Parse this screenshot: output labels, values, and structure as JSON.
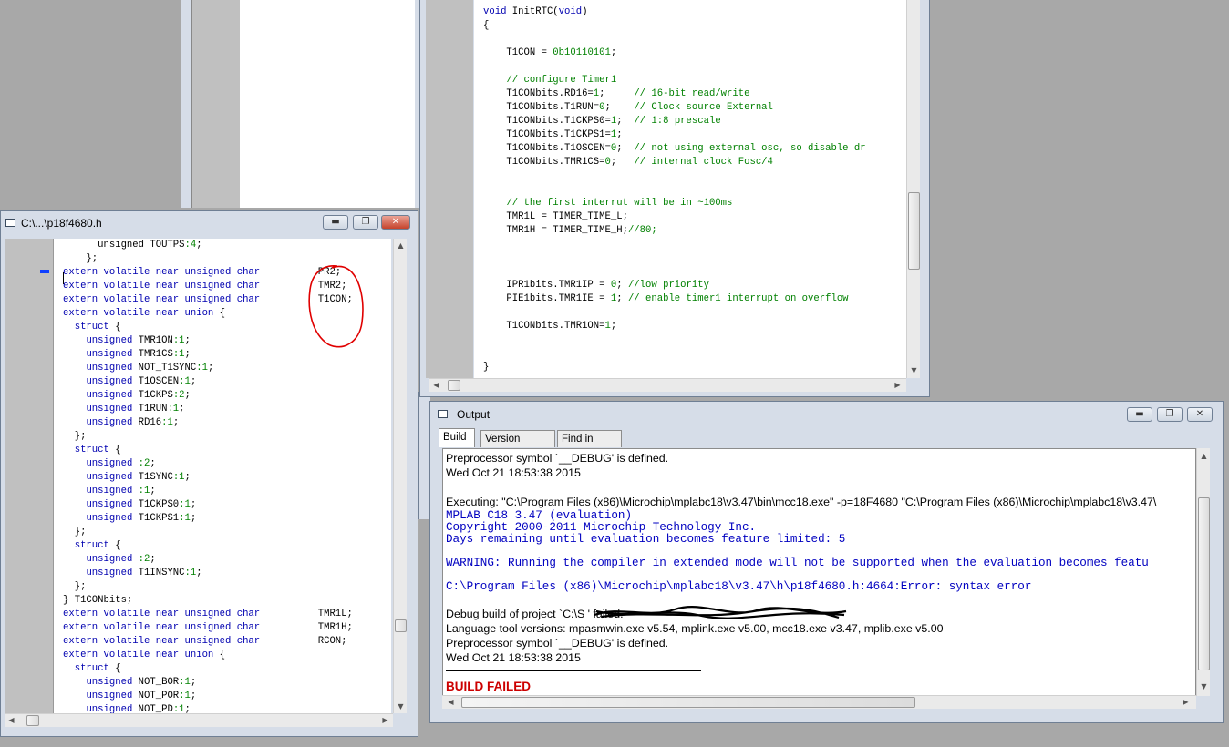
{
  "header_window": {
    "title": "C:\\...\\p18f4680.h",
    "lines": [
      [
        [
          "pl",
          "      unsigned "
        ],
        [
          "pl",
          "TOUTPS"
        ],
        [
          "nm",
          ":4"
        ],
        [
          "pl",
          ";"
        ]
      ],
      [
        [
          "pl",
          "    };"
        ]
      ],
      [
        [
          "kw",
          "extern volatile near unsigned char"
        ],
        [
          "pl",
          "          PR2;"
        ]
      ],
      [
        [
          "kw",
          "extern volatile near unsigned char"
        ],
        [
          "pl",
          "          TMR2;"
        ]
      ],
      [
        [
          "kw",
          "extern volatile near unsigned char"
        ],
        [
          "pl",
          "          T1CON;"
        ]
      ],
      [
        [
          "kw",
          "extern volatile near union"
        ],
        [
          "pl",
          " {"
        ]
      ],
      [
        [
          "pl",
          "  "
        ],
        [
          "kw",
          "struct"
        ],
        [
          "pl",
          " {"
        ]
      ],
      [
        [
          "pl",
          "    "
        ],
        [
          "kw",
          "unsigned"
        ],
        [
          "pl",
          " TMR1ON"
        ],
        [
          "nm",
          ":1"
        ],
        [
          "pl",
          ";"
        ]
      ],
      [
        [
          "pl",
          "    "
        ],
        [
          "kw",
          "unsigned"
        ],
        [
          "pl",
          " TMR1CS"
        ],
        [
          "nm",
          ":1"
        ],
        [
          "pl",
          ";"
        ]
      ],
      [
        [
          "pl",
          "    "
        ],
        [
          "kw",
          "unsigned"
        ],
        [
          "pl",
          " NOT_T1SYNC"
        ],
        [
          "nm",
          ":1"
        ],
        [
          "pl",
          ";"
        ]
      ],
      [
        [
          "pl",
          "    "
        ],
        [
          "kw",
          "unsigned"
        ],
        [
          "pl",
          " T1OSCEN"
        ],
        [
          "nm",
          ":1"
        ],
        [
          "pl",
          ";"
        ]
      ],
      [
        [
          "pl",
          "    "
        ],
        [
          "kw",
          "unsigned"
        ],
        [
          "pl",
          " T1CKPS"
        ],
        [
          "nm",
          ":2"
        ],
        [
          "pl",
          ";"
        ]
      ],
      [
        [
          "pl",
          "    "
        ],
        [
          "kw",
          "unsigned"
        ],
        [
          "pl",
          " T1RUN"
        ],
        [
          "nm",
          ":1"
        ],
        [
          "pl",
          ";"
        ]
      ],
      [
        [
          "pl",
          "    "
        ],
        [
          "kw",
          "unsigned"
        ],
        [
          "pl",
          " RD16"
        ],
        [
          "nm",
          ":1"
        ],
        [
          "pl",
          ";"
        ]
      ],
      [
        [
          "pl",
          "  };"
        ]
      ],
      [
        [
          "pl",
          "  "
        ],
        [
          "kw",
          "struct"
        ],
        [
          "pl",
          " {"
        ]
      ],
      [
        [
          "pl",
          "    "
        ],
        [
          "kw",
          "unsigned"
        ],
        [
          "pl",
          " "
        ],
        [
          "nm",
          ":2"
        ],
        [
          "pl",
          ";"
        ]
      ],
      [
        [
          "pl",
          "    "
        ],
        [
          "kw",
          "unsigned"
        ],
        [
          "pl",
          " T1SYNC"
        ],
        [
          "nm",
          ":1"
        ],
        [
          "pl",
          ";"
        ]
      ],
      [
        [
          "pl",
          "    "
        ],
        [
          "kw",
          "unsigned"
        ],
        [
          "pl",
          " "
        ],
        [
          "nm",
          ":1"
        ],
        [
          "pl",
          ";"
        ]
      ],
      [
        [
          "pl",
          "    "
        ],
        [
          "kw",
          "unsigned"
        ],
        [
          "pl",
          " T1CKPS0"
        ],
        [
          "nm",
          ":1"
        ],
        [
          "pl",
          ";"
        ]
      ],
      [
        [
          "pl",
          "    "
        ],
        [
          "kw",
          "unsigned"
        ],
        [
          "pl",
          " T1CKPS1"
        ],
        [
          "nm",
          ":1"
        ],
        [
          "pl",
          ";"
        ]
      ],
      [
        [
          "pl",
          "  };"
        ]
      ],
      [
        [
          "pl",
          "  "
        ],
        [
          "kw",
          "struct"
        ],
        [
          "pl",
          " {"
        ]
      ],
      [
        [
          "pl",
          "    "
        ],
        [
          "kw",
          "unsigned"
        ],
        [
          "pl",
          " "
        ],
        [
          "nm",
          ":2"
        ],
        [
          "pl",
          ";"
        ]
      ],
      [
        [
          "pl",
          "    "
        ],
        [
          "kw",
          "unsigned"
        ],
        [
          "pl",
          " T1INSYNC"
        ],
        [
          "nm",
          ":1"
        ],
        [
          "pl",
          ";"
        ]
      ],
      [
        [
          "pl",
          "  };"
        ]
      ],
      [
        [
          "pl",
          "} T1CONbits;"
        ]
      ],
      [
        [
          "kw",
          "extern volatile near unsigned char"
        ],
        [
          "pl",
          "          TMR1L;"
        ]
      ],
      [
        [
          "kw",
          "extern volatile near unsigned char"
        ],
        [
          "pl",
          "          TMR1H;"
        ]
      ],
      [
        [
          "kw",
          "extern volatile near unsigned char"
        ],
        [
          "pl",
          "          RCON;"
        ]
      ],
      [
        [
          "kw",
          "extern volatile near union"
        ],
        [
          "pl",
          " {"
        ]
      ],
      [
        [
          "pl",
          "  "
        ],
        [
          "kw",
          "struct"
        ],
        [
          "pl",
          " {"
        ]
      ],
      [
        [
          "pl",
          "    "
        ],
        [
          "kw",
          "unsigned"
        ],
        [
          "pl",
          " NOT_BOR"
        ],
        [
          "nm",
          ":1"
        ],
        [
          "pl",
          ";"
        ]
      ],
      [
        [
          "pl",
          "    "
        ],
        [
          "kw",
          "unsigned"
        ],
        [
          "pl",
          " NOT_POR"
        ],
        [
          "nm",
          ":1"
        ],
        [
          "pl",
          ";"
        ]
      ],
      [
        [
          "pl",
          "    "
        ],
        [
          "kw",
          "unsigned"
        ],
        [
          "pl",
          " NOT_PD"
        ],
        [
          "nm",
          ":1"
        ],
        [
          "pl",
          ";"
        ]
      ]
    ]
  },
  "source_window": {
    "lines": [
      [
        [
          "kw",
          "void"
        ],
        [
          "pl",
          " InitRTC("
        ],
        [
          "kw",
          "void"
        ],
        [
          "pl",
          ")"
        ]
      ],
      [
        [
          "pl",
          "{"
        ]
      ],
      [
        [
          "pl",
          ""
        ]
      ],
      [
        [
          "pl",
          "    T1CON = "
        ],
        [
          "nm",
          "0b10110101"
        ],
        [
          "pl",
          ";"
        ]
      ],
      [
        [
          "pl",
          ""
        ]
      ],
      [
        [
          "pl",
          "    "
        ],
        [
          "cm",
          "// configure Timer1"
        ]
      ],
      [
        [
          "pl",
          "    T1CONbits.RD16="
        ],
        [
          "nm",
          "1"
        ],
        [
          "pl",
          ";     "
        ],
        [
          "cm",
          "// 16-bit read/write"
        ]
      ],
      [
        [
          "pl",
          "    T1CONbits.T1RUN="
        ],
        [
          "nm",
          "0"
        ],
        [
          "pl",
          ";    "
        ],
        [
          "cm",
          "// Clock source External"
        ]
      ],
      [
        [
          "pl",
          "    T1CONbits.T1CKPS0="
        ],
        [
          "nm",
          "1"
        ],
        [
          "pl",
          ";  "
        ],
        [
          "cm",
          "// 1:8 prescale"
        ]
      ],
      [
        [
          "pl",
          "    T1CONbits.T1CKPS1="
        ],
        [
          "nm",
          "1"
        ],
        [
          "pl",
          ";"
        ]
      ],
      [
        [
          "pl",
          "    T1CONbits.T1OSCEN="
        ],
        [
          "nm",
          "0"
        ],
        [
          "pl",
          ";  "
        ],
        [
          "cm",
          "// not using external osc, so disable dr"
        ]
      ],
      [
        [
          "pl",
          "    T1CONbits.TMR1CS="
        ],
        [
          "nm",
          "0"
        ],
        [
          "pl",
          ";   "
        ],
        [
          "cm",
          "// internal clock Fosc/4"
        ]
      ],
      [
        [
          "pl",
          ""
        ]
      ],
      [
        [
          "pl",
          ""
        ]
      ],
      [
        [
          "pl",
          "    "
        ],
        [
          "cm",
          "// the first interrut will be in ~100ms"
        ]
      ],
      [
        [
          "pl",
          "    TMR1L = TIMER_TIME_L;"
        ]
      ],
      [
        [
          "pl",
          "    TMR1H = TIMER_TIME_H;"
        ],
        [
          "cm",
          "//80;"
        ]
      ],
      [
        [
          "pl",
          ""
        ]
      ],
      [
        [
          "pl",
          ""
        ]
      ],
      [
        [
          "pl",
          ""
        ]
      ],
      [
        [
          "pl",
          "    IPR1bits.TMR1IP = "
        ],
        [
          "nm",
          "0"
        ],
        [
          "pl",
          "; "
        ],
        [
          "cm",
          "//low priority"
        ]
      ],
      [
        [
          "pl",
          "    PIE1bits.TMR1IE = "
        ],
        [
          "nm",
          "1"
        ],
        [
          "pl",
          "; "
        ],
        [
          "cm",
          "// enable timer1 interrupt on overflow"
        ]
      ],
      [
        [
          "pl",
          ""
        ]
      ],
      [
        [
          "pl",
          "    T1CONbits.TMR1ON="
        ],
        [
          "nm",
          "1"
        ],
        [
          "pl",
          ";"
        ]
      ],
      [
        [
          "pl",
          ""
        ]
      ],
      [
        [
          "pl",
          ""
        ]
      ],
      [
        [
          "pl",
          "}"
        ]
      ]
    ]
  },
  "output_window": {
    "title": "Output",
    "tabs": [
      "Build",
      "Version Control",
      "Find in Files"
    ],
    "lines": [
      {
        "style": "sans",
        "text": "Preprocessor symbol `__DEBUG' is defined."
      },
      {
        "style": "sans",
        "text": "Wed Oct 21 18:53:38 2015"
      },
      {
        "style": "rule",
        "text": ""
      },
      {
        "style": "sans",
        "text": "Executing: \"C:\\Program Files (x86)\\Microchip\\mplabc18\\v3.47\\bin\\mcc18.exe\" -p=18F4680 \"C:\\Program Files (x86)\\Microchip\\mplabc18\\v3.47\\"
      },
      {
        "style": "mono",
        "text": "MPLAB C18 3.47 (evaluation)"
      },
      {
        "style": "mono",
        "text": "Copyright 2000-2011 Microchip Technology Inc."
      },
      {
        "style": "mono",
        "text": "Days remaining until evaluation becomes feature limited:  5"
      },
      {
        "style": "mono",
        "text": "WARNING:  Running the compiler in extended mode will not be supported when the evaluation becomes featu"
      },
      {
        "style": "mono",
        "text": "C:\\Program Files (x86)\\Microchip\\mplabc18\\v3.47\\h\\p18f4680.h:4664:Error: syntax error"
      },
      {
        "style": "sans",
        "text": "Debug build of project `C:\\S                                        ' failed."
      },
      {
        "style": "sans",
        "text": "Language tool versions: mpasmwin.exe v5.54, mplink.exe v5.00, mcc18.exe v3.47, mplib.exe v5.00"
      },
      {
        "style": "sans",
        "text": "Preprocessor symbol `__DEBUG' is defined."
      },
      {
        "style": "sans",
        "text": "Wed Oct 21 18:53:38 2015"
      },
      {
        "style": "rule",
        "text": ""
      },
      {
        "style": "fail",
        "text": "BUILD FAILED"
      }
    ]
  },
  "colors": {
    "keyword": "#0000b0",
    "comment": "#008000",
    "error": "#cc0000",
    "annotation": "#e00000"
  }
}
